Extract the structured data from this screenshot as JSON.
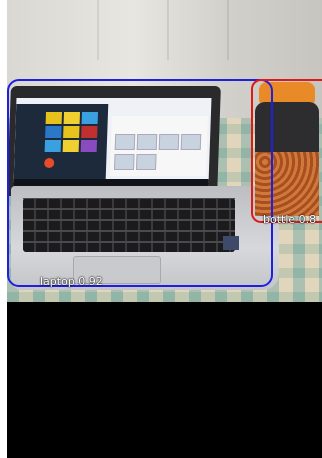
{
  "detections": [
    {
      "label": "laptop",
      "score": "0.92",
      "text": "laptop 0.92",
      "color": "#1f1fe0"
    },
    {
      "label": "bottle",
      "score": "0.8",
      "text": "bottle 0.8",
      "color": "#e01818"
    }
  ],
  "scene": {
    "objects": [
      "laptop-icon",
      "bottle-icon"
    ],
    "background_color_bottom": "#000000"
  }
}
